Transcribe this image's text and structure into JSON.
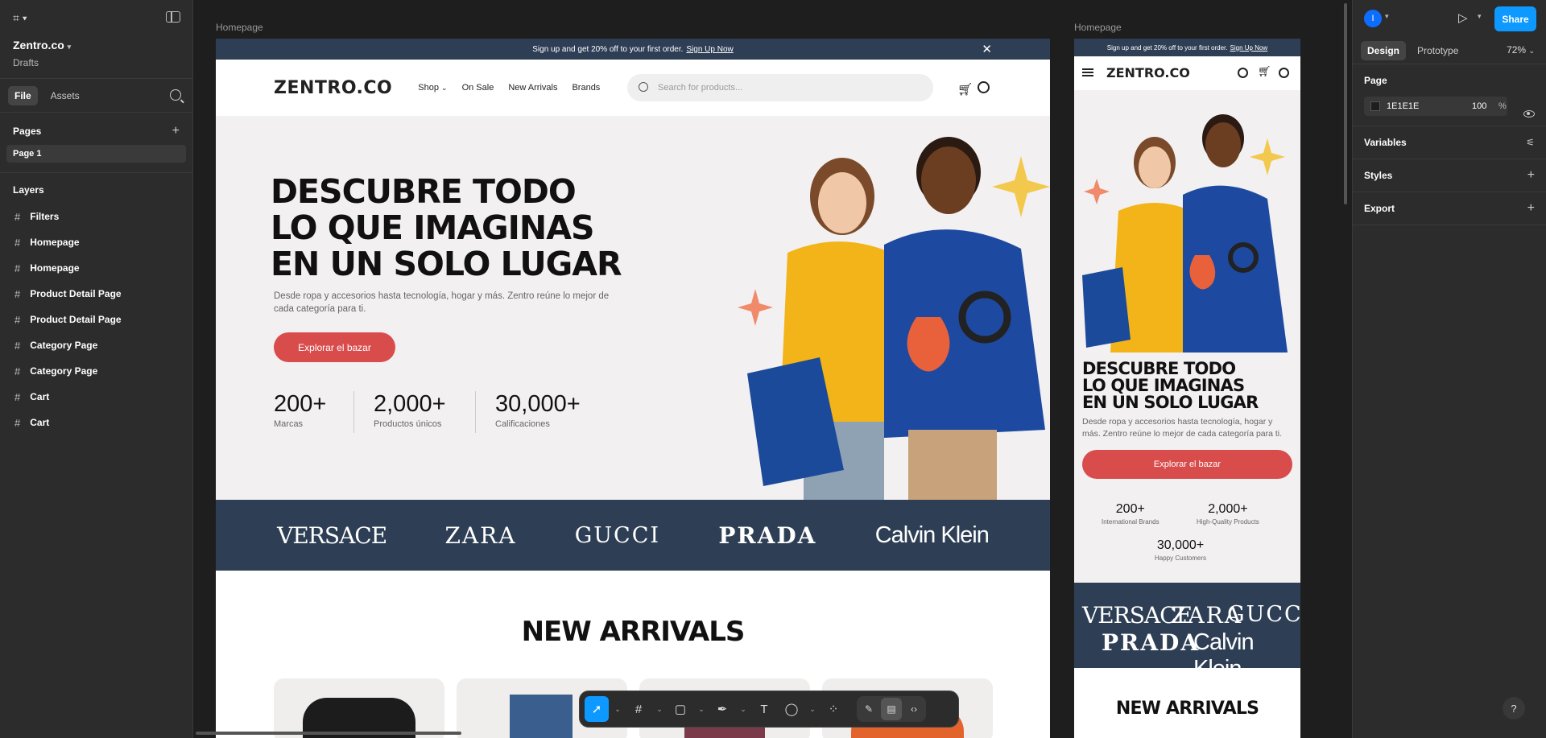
{
  "left": {
    "project_name": "Zentro.co",
    "project_location": "Drafts",
    "tabs": [
      "File",
      "Assets"
    ],
    "pages_title": "Pages",
    "pages": [
      "Page 1"
    ],
    "layers_title": "Layers",
    "layers": [
      "Filters",
      "Homepage",
      "Homepage",
      "Product Detail Page",
      "Product Detail Page",
      "Category Page",
      "Category Page",
      "Cart",
      "Cart"
    ]
  },
  "canvas": {
    "desktop_label": "Homepage",
    "mobile_label": "Homepage",
    "desktop": {
      "promo_text": "Sign up and get 20% off to your first order.",
      "promo_link": "Sign Up Now",
      "brand": "ZENTRO.CO",
      "nav": [
        "Shop",
        "On Sale",
        "New Arrivals",
        "Brands"
      ],
      "search_placeholder": "Search for products...",
      "hero_lines": [
        "DESCUBRE TODO",
        "LO QUE IMAGINAS",
        "EN UN SOLO LUGAR"
      ],
      "hero_desc": "Desde ropa y accesorios hasta tecnología, hogar y más. Zentro reúne lo mejor de cada categoría para ti.",
      "cta": "Explorar el bazar",
      "stats": [
        {
          "value": "200+",
          "label": "Marcas"
        },
        {
          "value": "2,000+",
          "label": "Productos únicos"
        },
        {
          "value": "30,000+",
          "label": "Calificaciones"
        }
      ],
      "brands": [
        "VERSACE",
        "ZARA",
        "GUCCI",
        "PRADA",
        "Calvin Klein"
      ],
      "section_title": "NEW ARRIVALS"
    },
    "mobile": {
      "promo_text": "Sign up and get 20% off to your first order.",
      "promo_link": "Sign Up Now",
      "brand": "ZENTRO.CO",
      "hero_lines": [
        "DESCUBRE TODO",
        "LO QUE IMAGINAS",
        "EN UN SOLO LUGAR"
      ],
      "hero_desc": "Desde ropa y accesorios hasta tecnología, hogar y más. Zentro reúne lo mejor de cada categoría para ti.",
      "cta": "Explorar el bazar",
      "stats": [
        {
          "value": "200+",
          "label": "International Brands"
        },
        {
          "value": "2,000+",
          "label": "High-Quality Products"
        },
        {
          "value": "30,000+",
          "label": "Happy Customers"
        }
      ],
      "brands": [
        "VERSACE",
        "ZARA",
        "GUCCI",
        "PRADA",
        "Calvin Klein"
      ],
      "section_title": "NEW ARRIVALS"
    }
  },
  "right": {
    "avatar_initial": "I",
    "share": "Share",
    "tabs": [
      "Design",
      "Prototype"
    ],
    "zoom": "72%",
    "page_title": "Page",
    "fill_hex": "1E1E1E",
    "fill_opacity": "100",
    "fill_unit": "%",
    "variables": "Variables",
    "styles": "Styles",
    "export": "Export"
  },
  "help": "?",
  "colors": {
    "accent": "#0d99ff",
    "hero_bg": "#f2f0f1",
    "navy": "#2e3f55",
    "cta": "#d94c4c"
  }
}
